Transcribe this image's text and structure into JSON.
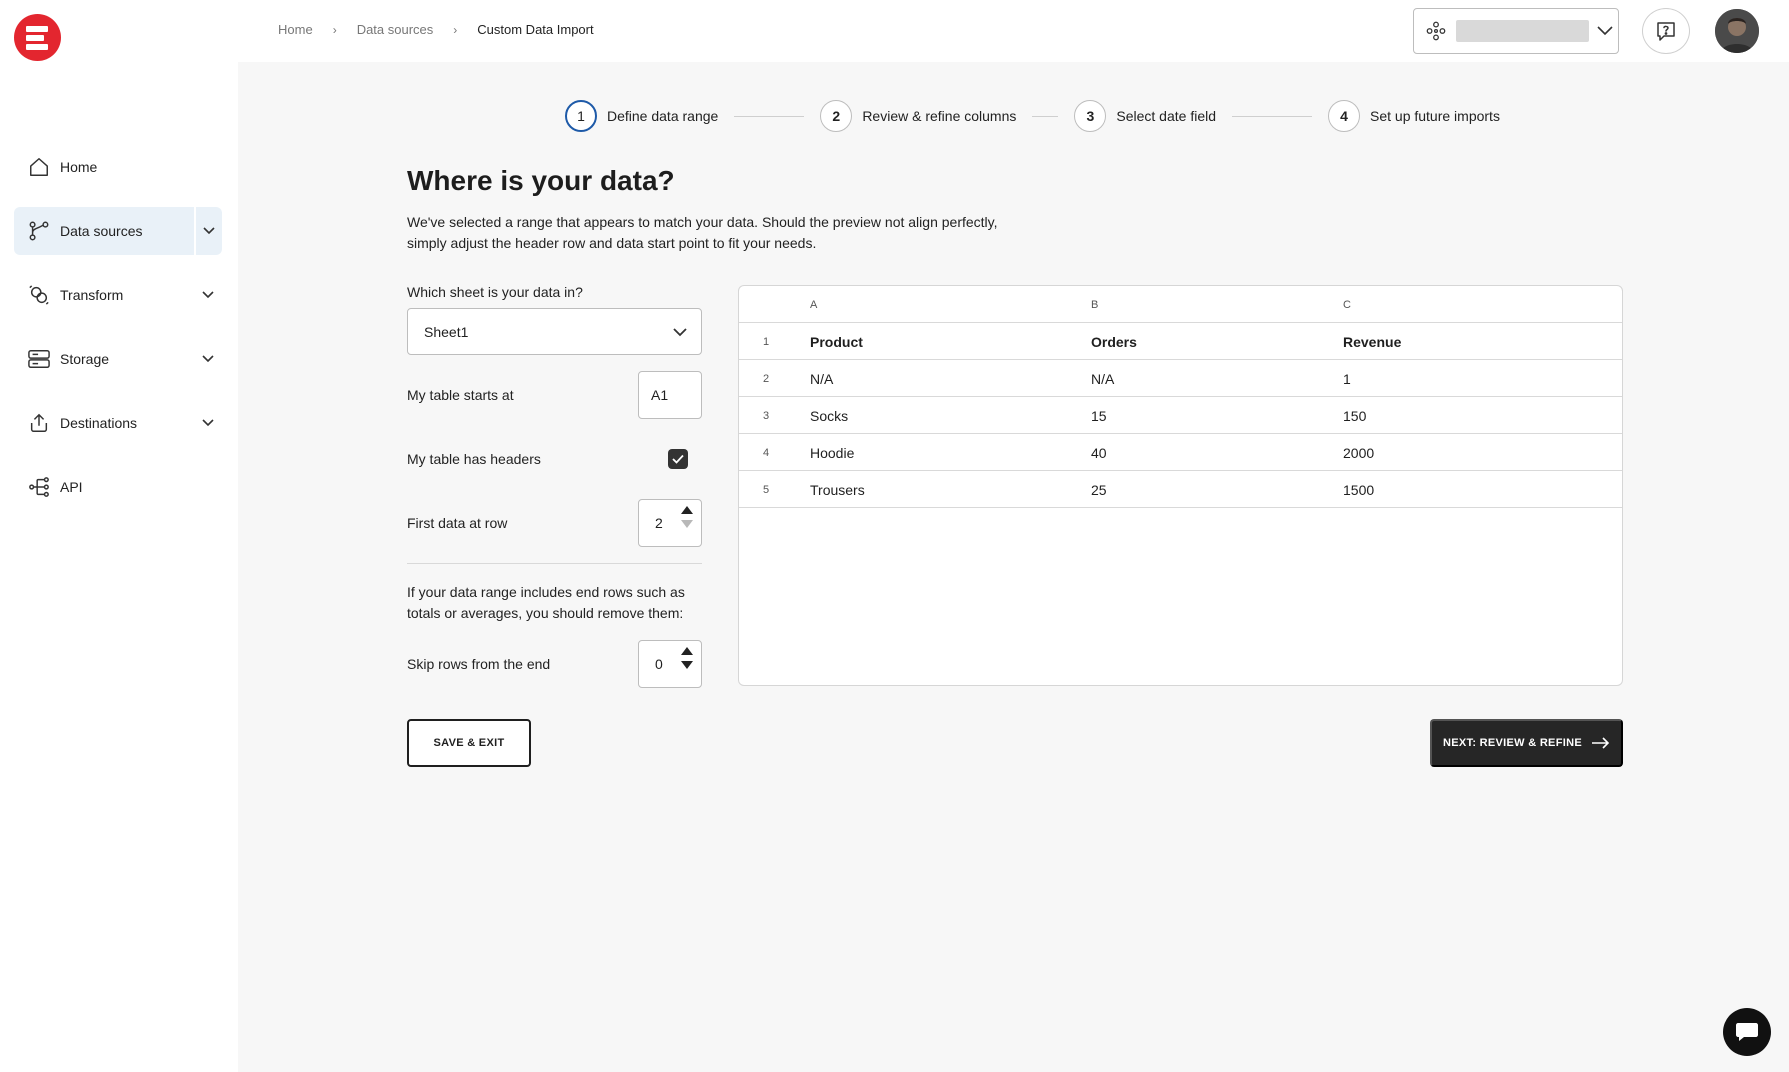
{
  "breadcrumb": {
    "items": [
      "Home",
      "Data sources",
      "Custom Data Import"
    ],
    "separator": "›"
  },
  "sidebar": {
    "items": [
      {
        "label": "Home",
        "icon": "home-icon",
        "expandable": false,
        "active": false
      },
      {
        "label": "Data sources",
        "icon": "data-sources-icon",
        "expandable": true,
        "active": true
      },
      {
        "label": "Transform",
        "icon": "transform-icon",
        "expandable": true,
        "active": false
      },
      {
        "label": "Storage",
        "icon": "storage-icon",
        "expandable": true,
        "active": false
      },
      {
        "label": "Destinations",
        "icon": "destinations-icon",
        "expandable": true,
        "active": false
      },
      {
        "label": "API",
        "icon": "api-icon",
        "expandable": false,
        "active": false
      }
    ]
  },
  "stepper": {
    "steps": [
      {
        "num": "1",
        "label": "Define data range",
        "current": true
      },
      {
        "num": "2",
        "label": "Review & refine columns",
        "current": false
      },
      {
        "num": "3",
        "label": "Select date field",
        "current": false
      },
      {
        "num": "4",
        "label": "Set up future imports",
        "current": false
      }
    ]
  },
  "main": {
    "title": "Where is your data?",
    "description": "We've selected a range that appears to match your data. Should the preview not align perfectly, simply adjust the header row and data start point to fit your needs."
  },
  "form": {
    "sheet_label": "Which sheet is your data in?",
    "sheet_value": "Sheet1",
    "table_start_label": "My table starts at",
    "table_start_value": "A1",
    "headers_label": "My table has headers",
    "headers_checked": true,
    "first_row_label": "First data at row",
    "first_row_value": "2",
    "end_rows_help": "If your data range includes end rows such as totals or averages, you should remove them:",
    "skip_rows_label": "Skip rows from the end",
    "skip_rows_value": "0"
  },
  "preview": {
    "column_letters": [
      "A",
      "B",
      "C"
    ],
    "rows": [
      {
        "n": "1",
        "cells": [
          "Product",
          "Orders",
          "Revenue"
        ],
        "header": true
      },
      {
        "n": "2",
        "cells": [
          "N/A",
          "N/A",
          "1"
        ],
        "header": false
      },
      {
        "n": "3",
        "cells": [
          "Socks",
          "15",
          "150"
        ],
        "header": false
      },
      {
        "n": "4",
        "cells": [
          "Hoodie",
          "40",
          "2000"
        ],
        "header": false
      },
      {
        "n": "5",
        "cells": [
          "Trousers",
          "25",
          "1500"
        ],
        "header": false
      }
    ]
  },
  "actions": {
    "save_label": "SAVE & EXIT",
    "next_label": "NEXT: REVIEW & REFINE"
  },
  "colors": {
    "active_nav_bg": "#e9f1f8",
    "current_step_ring": "#1e5aa8",
    "brand": "#e3262f",
    "primary_button": "#262626"
  }
}
